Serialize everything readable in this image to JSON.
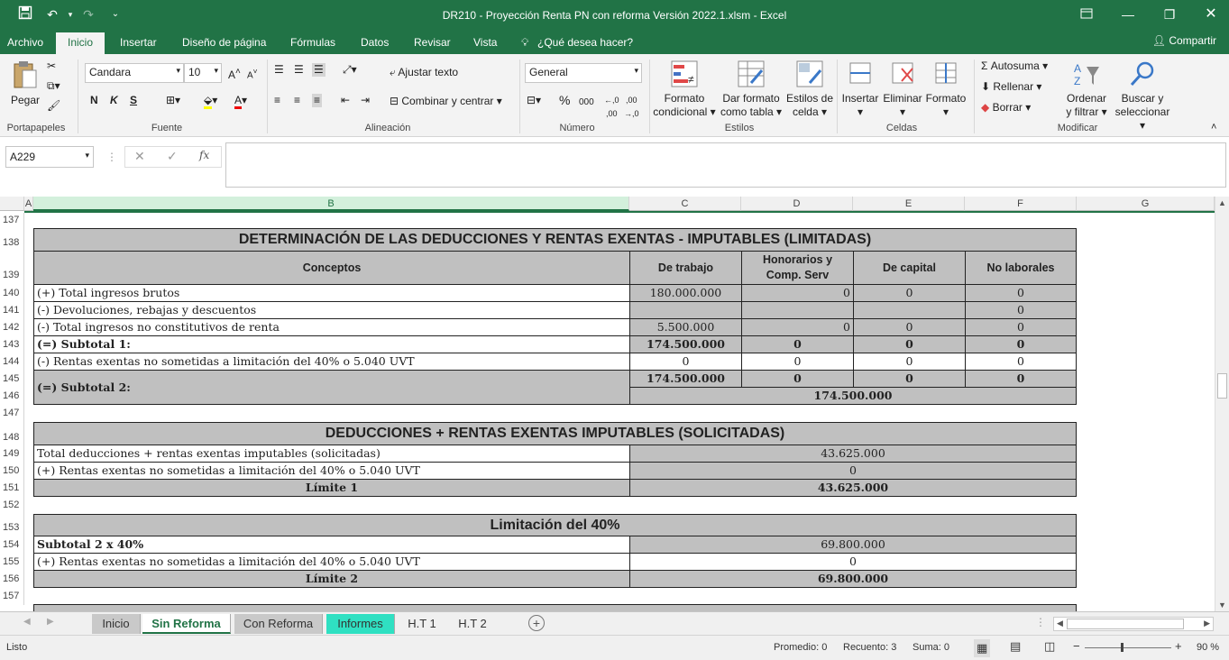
{
  "window": {
    "title": "DR210 - Proyección Renta PN con reforma Versión 2022.1.xlsm - Excel"
  },
  "menu": {
    "items": [
      "Archivo",
      "Inicio",
      "Insertar",
      "Diseño de página",
      "Fórmulas",
      "Datos",
      "Revisar",
      "Vista"
    ],
    "tell_me": "¿Qué desea hacer?",
    "share": "Compartir"
  },
  "ribbon": {
    "paste": "Pegar",
    "clipboard_label": "Portapapeles",
    "font_name": "Candara",
    "font_size": "10",
    "font_label": "Fuente",
    "bold": "N",
    "italic": "K",
    "underline": "S",
    "wrap_text": "Ajustar texto",
    "merge_center": "Combinar y centrar",
    "alignment_label": "Alineación",
    "number_format": "General",
    "percent": "%",
    "thousands": "000",
    "number_label": "Número",
    "cond_format_1": "Formato",
    "cond_format_2": "condicional",
    "format_table_1": "Dar formato",
    "format_table_2": "como tabla",
    "cell_styles_1": "Estilos de",
    "cell_styles_2": "celda",
    "styles_label": "Estilos",
    "insert": "Insertar",
    "delete": "Eliminar",
    "format": "Formato",
    "cells_label": "Celdas",
    "autosum": "Autosuma",
    "fill": "Rellenar",
    "clear": "Borrar",
    "sort_1": "Ordenar",
    "sort_2": "y filtrar",
    "find_1": "Buscar y",
    "find_2": "seleccionar",
    "editing_label": "Modificar"
  },
  "formula_bar": {
    "name_box": "A229",
    "formula": ""
  },
  "columns": [
    "A",
    "B",
    "C",
    "D",
    "E",
    "F",
    "G"
  ],
  "rows": [
    "137",
    "138",
    "139",
    "140",
    "141",
    "142",
    "143",
    "144",
    "145",
    "146",
    "147",
    "148",
    "149",
    "150",
    "151",
    "152",
    "153",
    "154",
    "155",
    "156",
    "157"
  ],
  "sheet": {
    "t1_title": "DETERMINACIÓN DE LAS DEDUCCIONES Y RENTAS EXENTAS  - IMPUTABLES (LIMITADAS)",
    "h_conceptos": "Conceptos",
    "h_trabajo": "De trabajo",
    "h_honorarios_1": "Honorarios y",
    "h_honorarios_2": "Comp. Serv",
    "h_capital": "De capital",
    "h_no_laborales": "No laborales",
    "r140": {
      "label": "(+) Total ingresos brutos",
      "c": "180.000.000",
      "d": "0",
      "e": "0",
      "f": "0"
    },
    "r141": {
      "label": "(-) Devoluciones, rebajas y descuentos",
      "c": "",
      "d": "",
      "e": "",
      "f": "0"
    },
    "r142": {
      "label": "(-) Total ingresos no constitutivos de renta",
      "c": "5.500.000",
      "d": "0",
      "e": "0",
      "f": "0"
    },
    "r143": {
      "label": "(=) Subtotal 1:",
      "c": "174.500.000",
      "d": "0",
      "e": "0",
      "f": "0"
    },
    "r144": {
      "label": "(-) Rentas exentas no sometidas a limitación del 40% o 5.040 UVT",
      "c": "0",
      "d": "0",
      "e": "0",
      "f": "0"
    },
    "r145": {
      "label": "(=) Subtotal 2:",
      "c": "174.500.000",
      "d": "0",
      "e": "0",
      "f": "0"
    },
    "r146": {
      "total": "174.500.000"
    },
    "t2_title": "DEDUCCIONES + RENTAS EXENTAS IMPUTABLES (SOLICITADAS)",
    "r149": {
      "label": "Total deducciones + rentas exentas imputables (solicitadas)",
      "value": "43.625.000"
    },
    "r150": {
      "label": "(+) Rentas exentas no sometidas a limitación del 40% o 5.040 UVT",
      "value": "0"
    },
    "r151": {
      "label": "Límite 1",
      "value": "43.625.000"
    },
    "t3_title": "Limitación del 40%",
    "r154": {
      "label": "Subtotal 2 x 40%",
      "value": "69.800.000"
    },
    "r155": {
      "label": "(+) Rentas exentas no sometidas a limitación del 40% o 5.040 UVT",
      "value": "0"
    },
    "r156": {
      "label": "Límite 2",
      "value": "69.800.000"
    }
  },
  "tabs": [
    {
      "label": "Inicio",
      "state": "normal"
    },
    {
      "label": "Sin Reforma",
      "state": "active"
    },
    {
      "label": "Con Reforma",
      "state": "normal"
    },
    {
      "label": "Informes",
      "state": "teal"
    },
    {
      "label": "H.T 1",
      "state": "plain"
    },
    {
      "label": "H.T 2",
      "state": "plain"
    }
  ],
  "status": {
    "mode": "Listo",
    "average": "Promedio: 0",
    "count": "Recuento: 3",
    "sum": "Suma: 0",
    "zoom": "90 %"
  }
}
